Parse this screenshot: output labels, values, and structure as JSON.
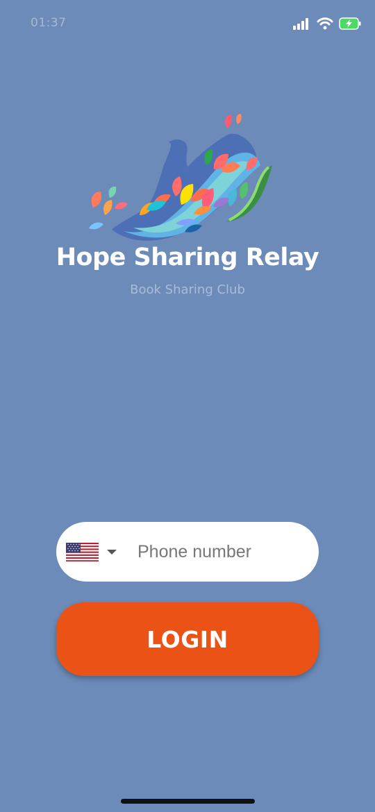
{
  "status_bar": {
    "time": "01:37",
    "icons": [
      "signal-icon",
      "wifi-icon",
      "battery-charging-icon"
    ]
  },
  "branding": {
    "logo_icon": "paint-splash-shoe-logo",
    "title": "Hope Sharing Relay",
    "subtitle": "Book Sharing Club"
  },
  "login_form": {
    "country_flag_icon": "us-flag-icon",
    "dropdown_icon": "chevron-down-icon",
    "phone_placeholder": "Phone number",
    "phone_value": "",
    "login_label": "LOGIN"
  },
  "colors": {
    "background": "#6c8bb8",
    "login_button": "#eb5316",
    "input_background": "#ffffff",
    "title": "#ffffff",
    "subtitle": "#a9bddb"
  }
}
